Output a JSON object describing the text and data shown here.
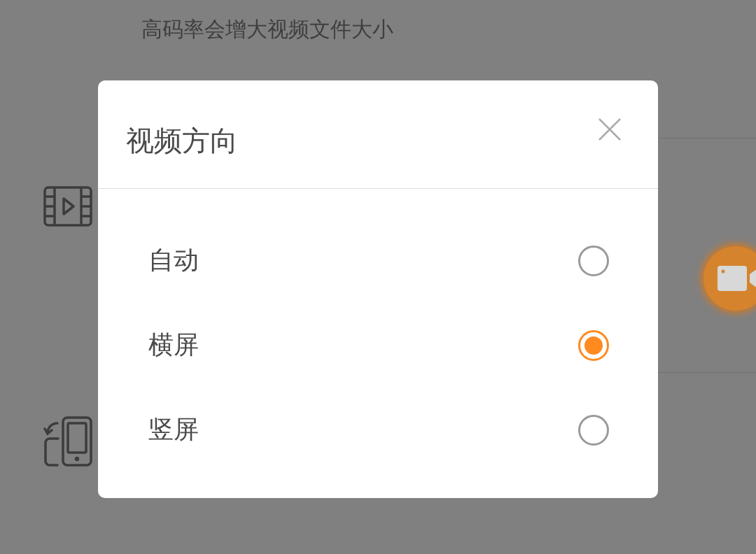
{
  "background_page": {
    "bitrate_hint": "高码率会增大视频文件大小"
  },
  "dialog": {
    "title": "视频方向",
    "options": [
      {
        "label": "自动",
        "selected": false
      },
      {
        "label": "横屏",
        "selected": true
      },
      {
        "label": "竖屏",
        "selected": false
      }
    ]
  }
}
